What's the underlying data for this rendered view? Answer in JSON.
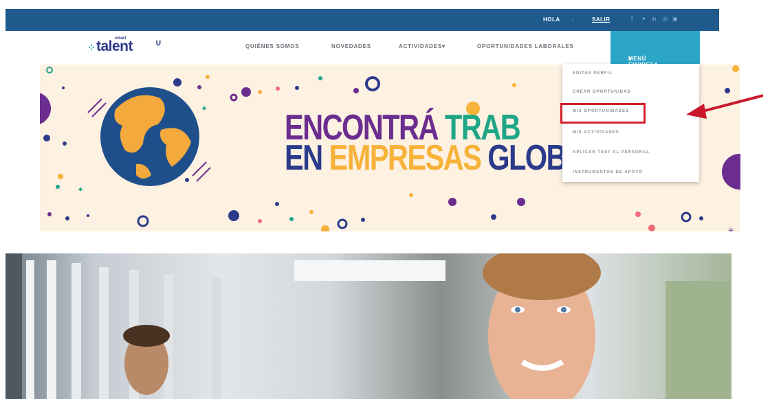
{
  "topbar": {
    "greeting": "HOLA",
    "separator": "-",
    "logout": "SALIR",
    "social_icons": [
      "facebook-icon",
      "twitter-icon",
      "linkedin-icon",
      "instagram-icon",
      "youtube-icon"
    ]
  },
  "logo": {
    "brand_small": "smart",
    "brand": "talent"
  },
  "nav": {
    "items": [
      "QUIÉNES SOMOS",
      "NOVEDADES",
      "ACTIVIDADES",
      "OPORTUNIDADES LABORALES"
    ],
    "company_menu": "MENÚ EMPRESA",
    "caret": "▾"
  },
  "banner": {
    "line1_a": "ENCONTRÁ ",
    "line1_b": "TRAB",
    "line2_a": "EN ",
    "line2_b": "EMPRESAS ",
    "line2_c": "GLOB"
  },
  "dropdown": {
    "items": [
      "EDITAR PERFIL",
      "CREAR OPORTUNIDAD",
      "MIS OPORTUNIDADES",
      "MIS ACTIVIDADES",
      "APLICAR TEST AL PERSONAL",
      "INSTRUMENTOS DE APOYO"
    ],
    "highlighted_index": 2
  },
  "colors": {
    "topbar": "#1f5a8c",
    "menu_active": "#2ba6c9",
    "highlight": "#d21f2b",
    "arrow": "#c9182b"
  }
}
